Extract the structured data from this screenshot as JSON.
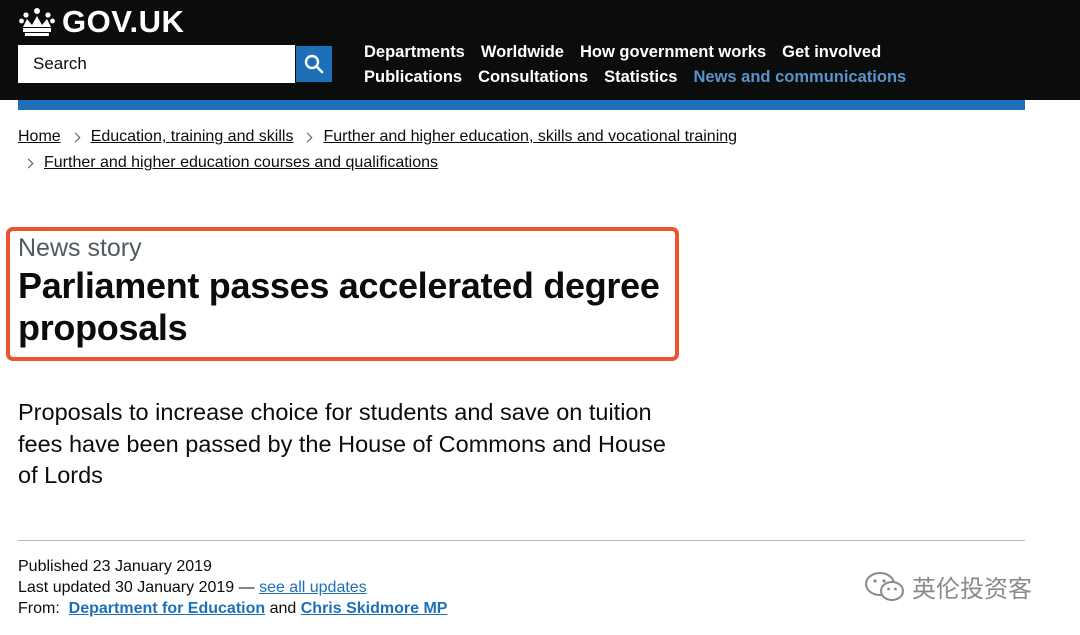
{
  "header": {
    "logo_text": "GOV.UK",
    "search_placeholder": "Search",
    "nav_row1": [
      "Departments",
      "Worldwide",
      "How government works",
      "Get involved"
    ],
    "nav_row2": [
      "Publications",
      "Consultations",
      "Statistics",
      "News and communications"
    ],
    "active_nav": "News and communications"
  },
  "breadcrumbs": {
    "home": "Home",
    "level1": "Education, training and skills",
    "level2": "Further and higher education, skills and vocational training",
    "level3": "Further and higher education courses and qualifications"
  },
  "article": {
    "caption": "News story",
    "title": "Parliament passes accelerated degree proposals",
    "lead": "Proposals to increase choice for students and save on tuition fees have been passed by the House of Commons and House of Lords"
  },
  "meta": {
    "published": "Published 23 January 2019",
    "updated": "Last updated 30 January 2019 — ",
    "see_updates": "see all updates",
    "from_label": "From:",
    "org1": "Department for Education",
    "and": "and",
    "org2": "Chris Skidmore MP"
  },
  "watermark": {
    "text": "英伦投资客"
  },
  "colors": {
    "header_bg": "#0b0c0c",
    "brand_blue": "#1d70b8",
    "highlight": "#e9552f",
    "active_link": "#5694ca"
  }
}
